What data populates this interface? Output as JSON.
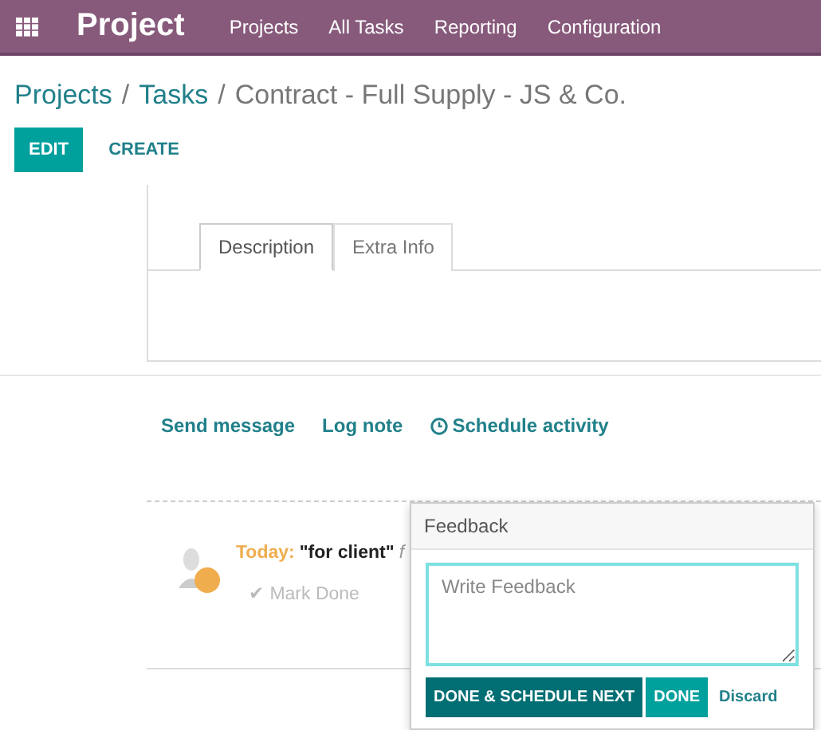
{
  "navbar": {
    "app": "Project",
    "menu": [
      "Projects",
      "All Tasks",
      "Reporting",
      "Configuration"
    ]
  },
  "breadcrumb": {
    "links": [
      {
        "label": "Projects",
        "separator": "/"
      },
      {
        "label": "Tasks",
        "separator": "/"
      }
    ],
    "current": "Contract - Full Supply - JS & Co."
  },
  "actions": [
    {
      "label": "EDIT",
      "kind": "primary"
    },
    {
      "label": "CREATE",
      "kind": "link"
    }
  ],
  "tabs": [
    {
      "label": "Description",
      "selected": true
    },
    {
      "label": "Extra Info",
      "selected": false
    }
  ],
  "chatter": [
    {
      "label": "Send message",
      "kind": "text"
    },
    {
      "label": "Log note",
      "kind": "text"
    },
    {
      "label": "Schedule activity",
      "kind": "clock"
    }
  ],
  "activity": {
    "due": "Today:",
    "summary": "\"for client\"",
    "note": "f",
    "mark_done": "✔ Mark Done"
  },
  "feedback_popover": {
    "title": "Feedback",
    "placeholder": "Write Feedback",
    "buttons": [
      {
        "label": "DONE & SCHEDULE NEXT",
        "kind": "dark"
      },
      {
        "label": "DONE",
        "kind": "primary"
      },
      {
        "label": "Discard",
        "kind": "link"
      }
    ]
  }
}
